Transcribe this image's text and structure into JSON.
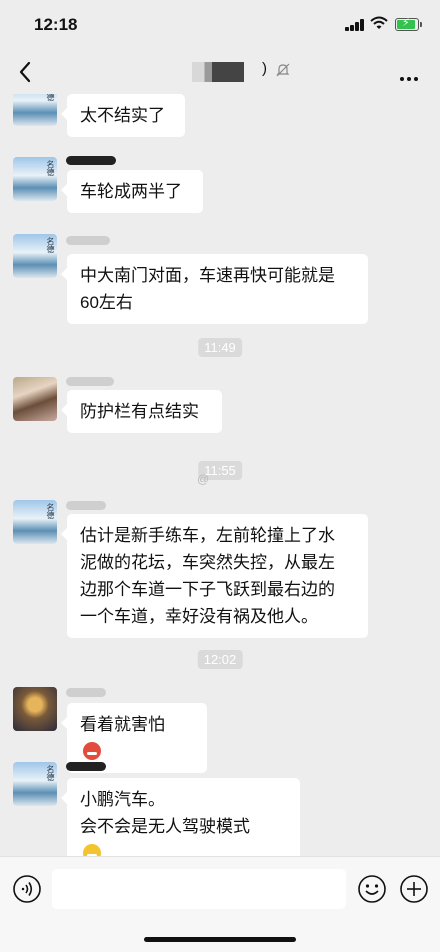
{
  "status_bar": {
    "time": "12:18"
  },
  "header": {
    "title_suffix": ")"
  },
  "messages": [
    {
      "text": [
        "太不结实了"
      ]
    },
    {
      "text": [
        "车轮成两半了"
      ]
    },
    {
      "text": [
        "中大南门对面，车速再快可能就是",
        "60左右"
      ]
    },
    {
      "text": [
        "防护栏有点结实"
      ]
    },
    {
      "text": [
        "估计是新手练车，左前轮撞上了水",
        "泥做的花坛，车突然失控，从最左",
        "边那个车道一下子飞跃到最右边的",
        "一个车道，幸好没有祸及他人。"
      ]
    },
    {
      "text": [
        "看着就害怕"
      ]
    },
    {
      "text": [
        "小鹏汽车。",
        "会不会是无人驾驶模式"
      ]
    }
  ],
  "timestamps": [
    "11:49",
    "11:55",
    "12:02"
  ],
  "watermark": "@",
  "colors": {
    "chat_bg": "#ededed",
    "bubble": "#ffffff",
    "battery": "#33c24d"
  }
}
